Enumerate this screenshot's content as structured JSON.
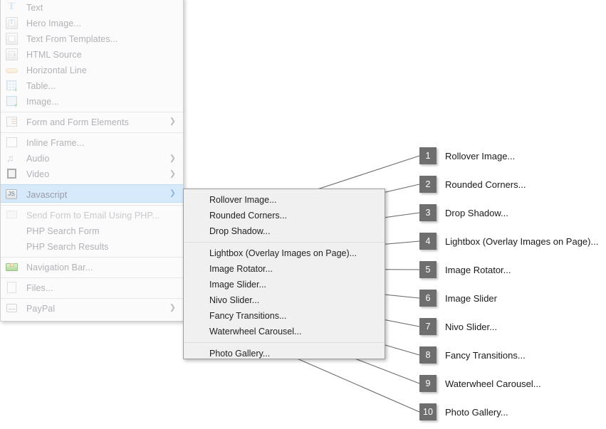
{
  "main_menu": {
    "items": [
      {
        "label": "Text",
        "icon": "text-icon",
        "arrow": false,
        "separator_above": false,
        "state": "disabled"
      },
      {
        "label": "Hero Image...",
        "icon": "hero-image-icon",
        "arrow": false,
        "separator_above": false,
        "state": "disabled"
      },
      {
        "label": "Text From Templates...",
        "icon": "text-template-icon",
        "arrow": false,
        "separator_above": false,
        "state": "disabled"
      },
      {
        "label": "HTML Source",
        "icon": "html-source-icon",
        "arrow": false,
        "separator_above": false,
        "state": "disabled"
      },
      {
        "label": "Horizontal Line",
        "icon": "horizontal-line-icon",
        "arrow": false,
        "separator_above": false,
        "state": "disabled"
      },
      {
        "label": "Table...",
        "icon": "table-icon",
        "arrow": false,
        "separator_above": false,
        "state": "disabled"
      },
      {
        "label": "Image...",
        "icon": "image-icon",
        "arrow": false,
        "separator_above": false,
        "state": "disabled"
      },
      {
        "label": "Form and Form Elements",
        "icon": "form-elements-icon",
        "arrow": true,
        "separator_above": true,
        "state": "disabled"
      },
      {
        "label": "Inline Frame...",
        "icon": "inline-frame-icon",
        "arrow": false,
        "separator_above": true,
        "state": "disabled"
      },
      {
        "label": "Audio",
        "icon": "audio-icon",
        "arrow": true,
        "separator_above": false,
        "state": "disabled"
      },
      {
        "label": "Video",
        "icon": "video-icon",
        "arrow": true,
        "separator_above": false,
        "state": "disabled"
      },
      {
        "label": "Javascript",
        "icon": "javascript-icon",
        "arrow": true,
        "separator_above": true,
        "state": "highlighted"
      },
      {
        "label": "Send Form to Email Using PHP...",
        "icon": "send-mail-icon",
        "arrow": false,
        "separator_above": true,
        "state": "dimmed"
      },
      {
        "label": "PHP Search Form",
        "icon": "none",
        "arrow": false,
        "separator_above": false,
        "state": "disabled"
      },
      {
        "label": "PHP Search Results",
        "icon": "none",
        "arrow": false,
        "separator_above": false,
        "state": "disabled"
      },
      {
        "label": "Navigation Bar...",
        "icon": "navigation-bar-icon",
        "arrow": false,
        "separator_above": true,
        "state": "disabled"
      },
      {
        "label": "Files...",
        "icon": "files-icon",
        "arrow": false,
        "separator_above": true,
        "state": "disabled"
      },
      {
        "label": "PayPal",
        "icon": "paypal-icon",
        "arrow": true,
        "separator_above": true,
        "state": "disabled"
      }
    ]
  },
  "submenu": {
    "parent": "Javascript",
    "items": [
      {
        "label": "Rollover Image...",
        "separator_above": false
      },
      {
        "label": "Rounded Corners...",
        "separator_above": false
      },
      {
        "label": "Drop Shadow...",
        "separator_above": false
      },
      {
        "label": "Lightbox (Overlay Images on Page)...",
        "separator_above": true
      },
      {
        "label": "Image Rotator...",
        "separator_above": false
      },
      {
        "label": "Image Slider...",
        "separator_above": false
      },
      {
        "label": "Nivo Slider...",
        "separator_above": false
      },
      {
        "label": "Fancy Transitions...",
        "separator_above": false
      },
      {
        "label": "Waterwheel Carousel...",
        "separator_above": false
      },
      {
        "label": "Photo Gallery...",
        "separator_above": true
      }
    ]
  },
  "callouts": {
    "badge_color": "#6e6e6e",
    "badge_text_color": "#ffffff",
    "leader_line_color": "#6a6a6a",
    "items": [
      {
        "number": "1",
        "label": "Rollover Image..."
      },
      {
        "number": "2",
        "label": "Rounded Corners..."
      },
      {
        "number": "3",
        "label": "Drop Shadow..."
      },
      {
        "number": "4",
        "label": "Lightbox (Overlay Images on Page)..."
      },
      {
        "number": "5",
        "label": "Image Rotator..."
      },
      {
        "number": "6",
        "label": "Image Slider"
      },
      {
        "number": "7",
        "label": "Nivo Slider..."
      },
      {
        "number": "8",
        "label": "Fancy Transitions..."
      },
      {
        "number": "9",
        "label": "Waterwheel Carousel..."
      },
      {
        "number": "10",
        "label": "Photo Gallery..."
      }
    ]
  },
  "colors": {
    "menu_background": "#fbfbfb",
    "submenu_background": "#f0f0f0",
    "highlight_background": "#d7eafc",
    "disabled_text": "#b4b0b8",
    "submenu_text": "#222222"
  }
}
